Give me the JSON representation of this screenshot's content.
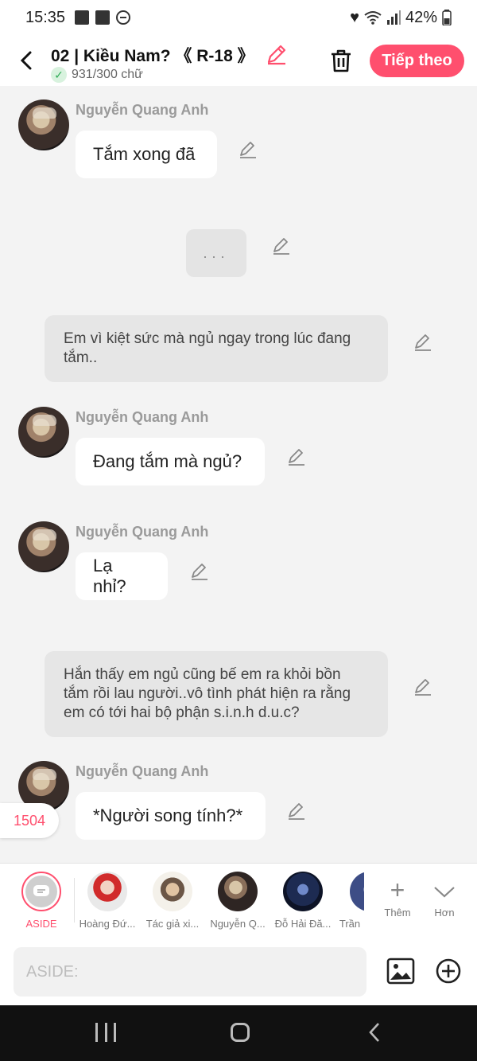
{
  "status_bar": {
    "time": "15:35",
    "battery": "42%"
  },
  "header": {
    "title": "02 | Kiều Nam? 《 R-18 》",
    "word_count": "931/300 chữ",
    "next_label": "Tiếp theo"
  },
  "messages": [
    {
      "type": "character",
      "name": "Nguyễn Quang Anh",
      "text": "Tắm xong đã"
    },
    {
      "type": "ellipsis",
      "text": "..."
    },
    {
      "type": "narration",
      "text": "Em vì kiệt sức mà ngủ ngay trong lúc đang tắm.."
    },
    {
      "type": "character",
      "name": "Nguyễn Quang Anh",
      "text": "Đang tắm mà ngủ?"
    },
    {
      "type": "character",
      "name": "Nguyễn Quang Anh",
      "text": "Lạ nhỉ?"
    },
    {
      "type": "narration",
      "text": "Hắn thấy em ngủ cũng bế em ra khỏi bồn tắm rồi lau người..vô tình phát hiện ra rằng em có tới hai bộ phận s.i.n.h d.u.c?"
    },
    {
      "type": "character",
      "name": "Nguyễn Quang Anh",
      "text": "*Người song tính?*"
    }
  ],
  "floating_badge": "1504",
  "characters": [
    {
      "label": "ASIDE"
    },
    {
      "label": "Hoàng Đứ..."
    },
    {
      "label": "Tác giả xi..."
    },
    {
      "label": "Nguyễn Q..."
    },
    {
      "label": "Đỗ Hải Đă..."
    },
    {
      "label": "Trần"
    }
  ],
  "controls": {
    "add_label": "Thêm",
    "more_label": "Hơn"
  },
  "input": {
    "placeholder": "ASIDE:"
  },
  "colors": {
    "accent": "#ff4f6e",
    "narration_bg": "#e6e6e6",
    "page_bg": "#f3f3f3"
  }
}
